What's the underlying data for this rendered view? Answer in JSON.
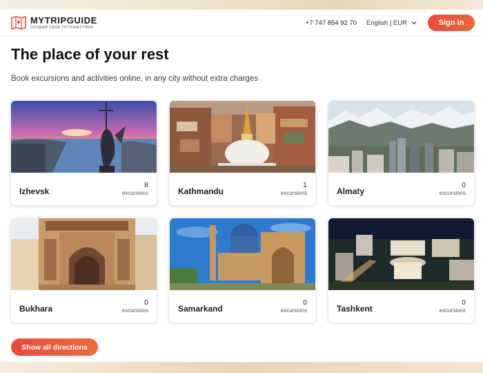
{
  "header": {
    "logo_title": "MYTRIPGUIDE",
    "logo_subtitle": "СОЗДАЙ СВОЕ ПУТЕШЕСТВИЕ",
    "phone": "+7 747 854 92 70",
    "language": "English | EUR",
    "signin_label": "Sign in"
  },
  "main": {
    "title": "The place of your rest",
    "subtitle": "Book excursions and activities online, in any city without extra charges",
    "show_all_label": "Show all directions"
  },
  "cities": [
    {
      "name": "Izhevsk",
      "count": "8",
      "count_label": "excursions"
    },
    {
      "name": "Kathmandu",
      "count": "1",
      "count_label": "excursions"
    },
    {
      "name": "Almaty",
      "count": "0",
      "count_label": "excursions"
    },
    {
      "name": "Bukhara",
      "count": "0",
      "count_label": "excursions"
    },
    {
      "name": "Samarkand",
      "count": "0",
      "count_label": "excursions"
    },
    {
      "name": "Tashkent",
      "count": "0",
      "count_label": "excursions"
    }
  ],
  "colors": {
    "accent": "#e84a3a",
    "accent_end": "#e96b3d"
  }
}
